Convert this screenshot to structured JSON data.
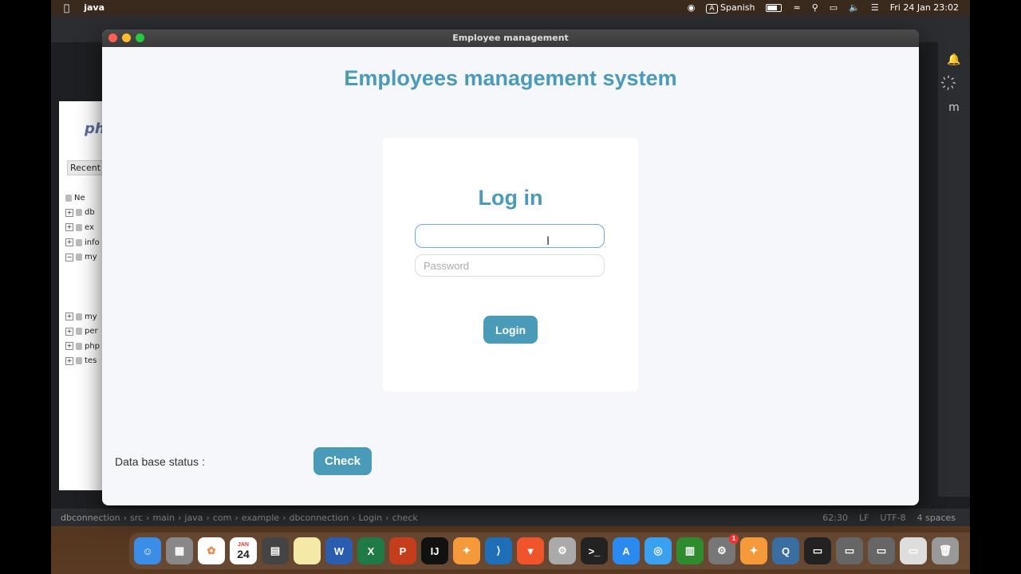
{
  "menubar": {
    "app_name": "java",
    "input_source": "Spanish",
    "input_badge": "A",
    "datetime": "Fri 24 Jan  23:02"
  },
  "ide": {
    "status_crumbs": [
      "dbconnection",
      "src",
      "main",
      "java",
      "com",
      "example",
      "dbconnection",
      "Login",
      "check"
    ],
    "position": "62:30",
    "line_ending": "LF",
    "encoding": "UTF-8",
    "indent": "4 spaces"
  },
  "browser": {
    "logo": "ph",
    "recent_label": "Recent",
    "tree": [
      "Ne",
      "db",
      "ex",
      "info",
      "my",
      "",
      "",
      "",
      "my",
      "per",
      "php",
      "tes"
    ]
  },
  "window": {
    "title": "Employee management",
    "heading": "Employees management system",
    "login": {
      "title": "Log in",
      "username_value": "",
      "password_placeholder": "Password",
      "button_label": "Login"
    },
    "db_status_label": "Data base status :",
    "check_label": "Check"
  },
  "dock": {
    "calendar_month": "JAN",
    "calendar_day": "24",
    "badge_count": "1"
  },
  "colors": {
    "accent": "#4a9ab9",
    "window_bg": "#f5f7fa"
  }
}
